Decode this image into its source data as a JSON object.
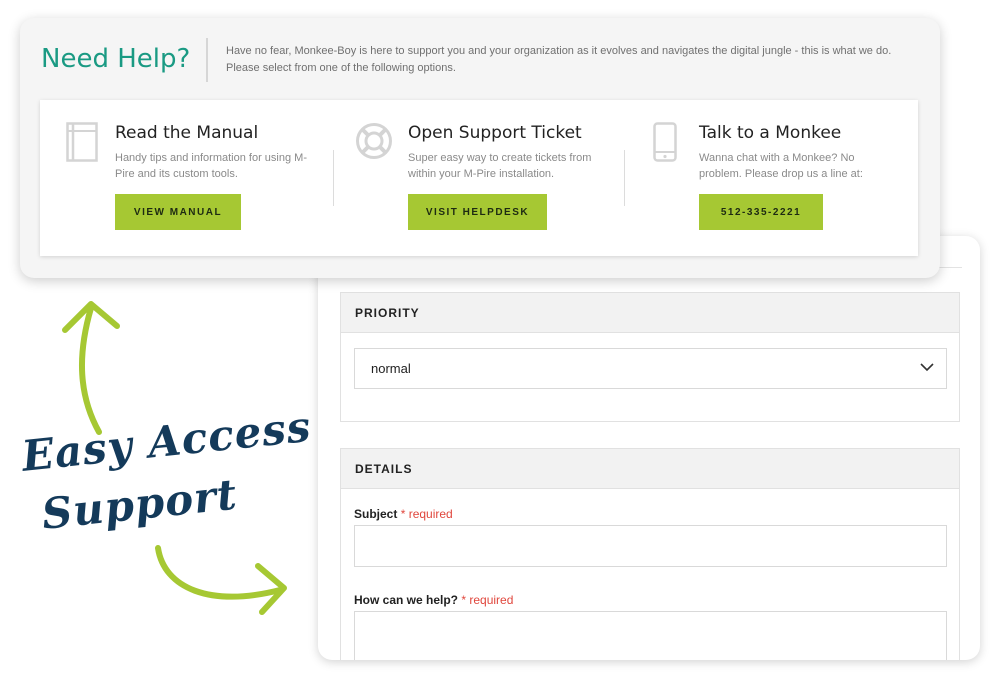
{
  "help": {
    "title": "Need Help?",
    "intro": "Have no fear, Monkee-Boy is here to support you and your organization as it evolves and navigates the digital jungle - this is what we do. Please select from one of the following options."
  },
  "options": [
    {
      "icon": "book-icon",
      "title": "Read the Manual",
      "description": "Handy tips and information for using M-Pire and its custom tools.",
      "button": "VIEW MANUAL"
    },
    {
      "icon": "lifebuoy-icon",
      "title": "Open Support Ticket",
      "description": "Super easy way to create tickets from within your M-Pire installation.",
      "button": "VISIT HELPDESK"
    },
    {
      "icon": "phone-icon",
      "title": "Talk to a Monkee",
      "description": "Wanna chat with a Monkee? No problem. Please drop us a line at:",
      "button": "512-335-2221"
    }
  ],
  "form": {
    "priority": {
      "heading": "PRIORITY",
      "selected": "normal"
    },
    "details": {
      "heading": "DETAILS",
      "subject_label": "Subject",
      "help_label": "How can we help?",
      "required_text": "* required"
    }
  },
  "callout": {
    "line1": "Easy Access",
    "line2": "Support"
  },
  "colors": {
    "accent_green": "#a6c833",
    "title_teal": "#1a9a83",
    "script_navy": "#143a5a",
    "required_red": "#e0463c"
  }
}
